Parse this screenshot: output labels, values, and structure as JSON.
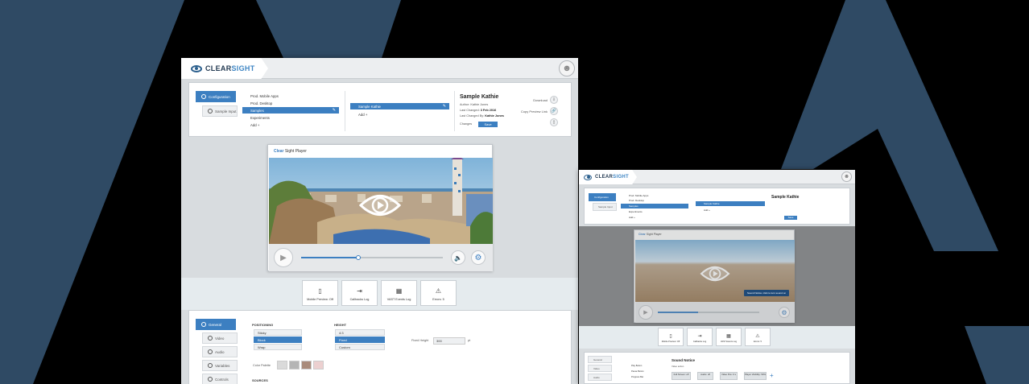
{
  "app": {
    "logo_a": "CLEAR",
    "logo_b": "SIGHT"
  },
  "config": {
    "tabs": [
      "Configuration",
      "Sample Input"
    ],
    "list": [
      "Prod. Mobile Apps",
      "Prod. Desktop",
      "Samples",
      "Experiments",
      "Add +"
    ],
    "samples": [
      "Sample Kathie",
      "Add +"
    ],
    "info": {
      "title": "Sample Kathie",
      "author_label": "Author:",
      "author": "Kathie Jones",
      "changed_label": "Last Changed:",
      "changed": "3 Feb 2016",
      "by_label": "Last Changed By:",
      "by": "Kathie Jones",
      "changes_label": "Changes",
      "save": "Save"
    },
    "actions": [
      "Download",
      "Copy Preview Link"
    ]
  },
  "player": {
    "title_a": "Clear",
    "title_b": "Sight Player"
  },
  "tools": [
    "Mobile Preview: Off",
    "Callbacks Log",
    "VAST Events Log",
    "Errors: 5"
  ],
  "settings": {
    "tabs": [
      "General",
      "Video",
      "Audio",
      "Variables",
      "Controls"
    ],
    "positioning": {
      "label": "POSITIONING",
      "options": [
        "Sticky",
        "Block",
        "Wrap"
      ]
    },
    "height": {
      "label": "HEIGHT",
      "options": [
        "4:3",
        "Fixed",
        "Custom"
      ]
    },
    "fixed_height": {
      "label": "Fixed Height",
      "value": "300",
      "unit": "pt"
    },
    "palette_label": "Color Palette",
    "sources_label": "SOURCES"
  },
  "tooltip": "Sound Notice: click to turn sound on",
  "sound_notice": {
    "title": "Sound Notice",
    "subtitle": "Video action",
    "actions": [
      "Play Button",
      "Pause Button",
      "Progress Bar"
    ],
    "flow": [
      "Full Screen: off",
      "Audio: off",
      "Video Pos: 0 s",
      "Player Visibility: 50%"
    ]
  }
}
